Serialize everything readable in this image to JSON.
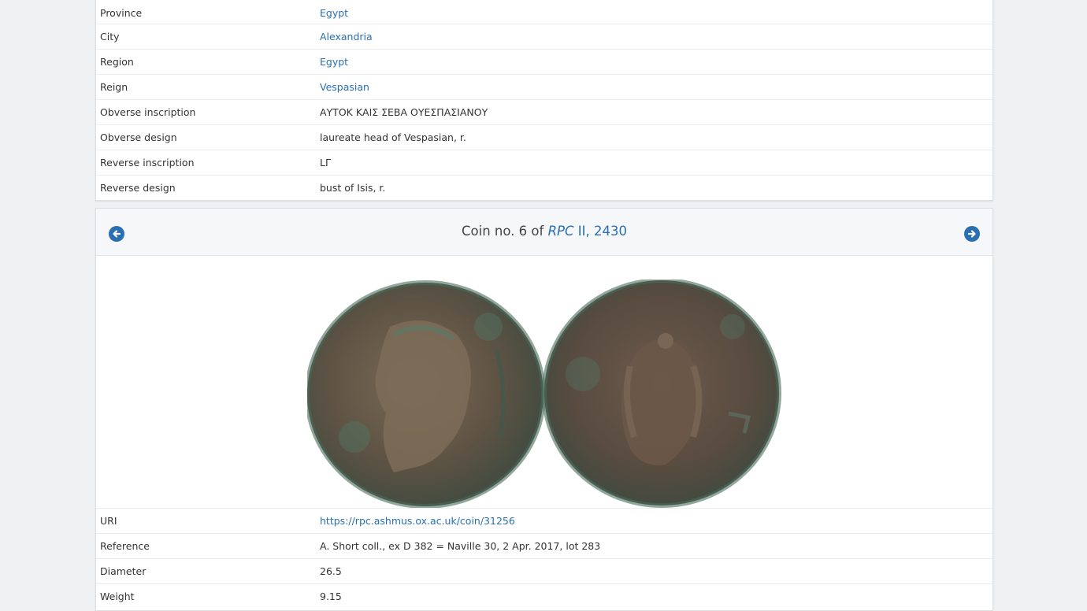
{
  "attributes": [
    {
      "label": "Province",
      "value": "Egypt",
      "link": true
    },
    {
      "label": "City",
      "value": "Alexandria",
      "link": true
    },
    {
      "label": "Region",
      "value": "Egypt",
      "link": true
    },
    {
      "label": "Reign",
      "value": "Vespasian",
      "link": true
    },
    {
      "label": "Obverse inscription",
      "value": "ΑΥΤΟΚ ΚΑΙΣ ΣΕΒΑ ΟΥΕΣΠΑΣΙΑΝΟΥ",
      "link": false
    },
    {
      "label": "Obverse design",
      "value": "laureate head of Vespasian, r.",
      "link": false
    },
    {
      "label": "Reverse inscription",
      "value": "LΓ",
      "link": false
    },
    {
      "label": "Reverse design",
      "value": "bust of Isis, r.",
      "link": false
    }
  ],
  "coin": {
    "title_prefix": "Coin no. 6 of ",
    "ref_italic": "RPC",
    "ref_rest": " II, 2430",
    "prev_icon": "arrow-left-circle-icon",
    "next_icon": "arrow-right-circle-icon",
    "image_name": "coin-obverse-reverse-image",
    "details": [
      {
        "label": "URI",
        "value": "https://rpc.ashmus.ox.ac.uk/coin/31256",
        "link": true
      },
      {
        "label": "Reference",
        "value": "A. Short coll., ex D 382 = Naville 30, 2 Apr. 2017, lot 283",
        "link": false
      },
      {
        "label": "Diameter",
        "value": "26.5",
        "link": false
      },
      {
        "label": "Weight",
        "value": "9.15",
        "link": false
      }
    ]
  },
  "colors": {
    "link": "#2a6fb0",
    "coin_bronze": "#6b5a45",
    "patina": "#4f7a6a"
  }
}
